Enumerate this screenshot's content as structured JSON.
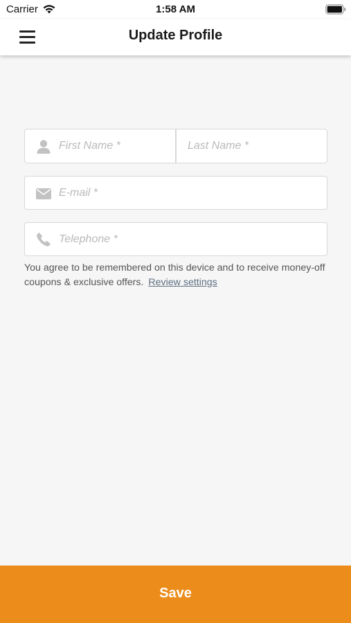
{
  "status_bar": {
    "carrier": "Carrier",
    "time": "1:58 AM",
    "wifi_icon": "wifi-icon",
    "battery_icon": "battery-icon"
  },
  "header": {
    "title": "Update Profile",
    "menu_icon": "hamburger-menu-icon"
  },
  "form": {
    "first_name": {
      "value": "",
      "placeholder": "First Name *",
      "icon": "person-icon"
    },
    "last_name": {
      "value": "",
      "placeholder": "Last Name *"
    },
    "email": {
      "value": "",
      "placeholder": "E-mail *",
      "icon": "envelope-icon"
    },
    "telephone": {
      "value": "",
      "placeholder": "Telephone *",
      "icon": "phone-icon"
    }
  },
  "consent": {
    "text": "You agree to be remembered on this device and to receive money-off coupons & exclusive offers.",
    "link_label": "Review settings"
  },
  "footer": {
    "save_label": "Save"
  },
  "colors": {
    "accent": "#ec8c1b",
    "background": "#f6f6f6",
    "field_border": "#d7d7d7",
    "placeholder": "#b9b9b9",
    "icon": "#c2c2c2"
  }
}
